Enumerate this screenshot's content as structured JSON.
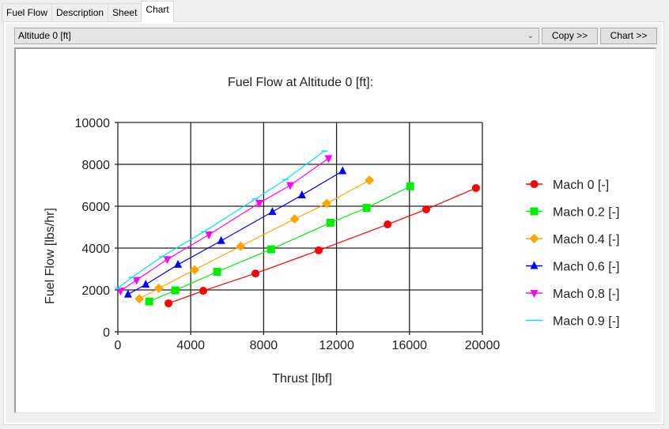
{
  "tabs": [
    {
      "label": "Fuel Flow",
      "active": false
    },
    {
      "label": "Description",
      "active": false
    },
    {
      "label": "Sheet",
      "active": false
    },
    {
      "label": "Chart",
      "active": true
    }
  ],
  "toolbar": {
    "selector_value": "Altitude 0 [ft]",
    "copy_label": "Copy >>",
    "chart_label": "Chart >>"
  },
  "chart_data": {
    "type": "line",
    "title": "Fuel Flow at Altitude 0 [ft]:",
    "xlabel": "Thrust [lbf]",
    "ylabel": "Fuel Flow [lbs/hr]",
    "xlim": [
      0,
      20000
    ],
    "ylim": [
      0,
      10000
    ],
    "xticks": [
      "0",
      "4000",
      "8000",
      "12000",
      "16000",
      "20000"
    ],
    "yticks": [
      "0",
      "2000",
      "4000",
      "6000",
      "8000",
      "10000"
    ],
    "grid": true,
    "legend_position": "right",
    "series": [
      {
        "name": "Mach 0 [-]",
        "color": "#ff0000",
        "marker": "circle",
        "x": [
          2780,
          4690,
          7550,
          11020,
          14800,
          16920,
          19650
        ],
        "y": [
          1360,
          1960,
          2790,
          3890,
          5130,
          5850,
          6870
        ]
      },
      {
        "name": "Mach 0.2 [-]",
        "color": "#00ee00",
        "marker": "square",
        "x": [
          1720,
          3150,
          5450,
          8410,
          11660,
          13650,
          16040
        ],
        "y": [
          1450,
          1980,
          2870,
          3940,
          5210,
          5920,
          6950
        ]
      },
      {
        "name": "Mach 0.4 [-]",
        "color": "#ffa500",
        "marker": "diamond",
        "x": [
          1180,
          2250,
          4210,
          6740,
          9700,
          11460,
          13800
        ],
        "y": [
          1580,
          2080,
          2960,
          4090,
          5390,
          6130,
          7240
        ]
      },
      {
        "name": "Mach 0.6 [-]",
        "color": "#0000ff",
        "marker": "triangle-up",
        "x": [
          560,
          1530,
          3300,
          5670,
          8480,
          10100,
          12330
        ],
        "y": [
          1790,
          2260,
          3210,
          4350,
          5730,
          6530,
          7680
        ]
      },
      {
        "name": "Mach 0.8 [-]",
        "color": "#ff00ff",
        "marker": "triangle-down",
        "x": [
          150,
          1030,
          2710,
          5000,
          7760,
          9460,
          11560
        ],
        "y": [
          1960,
          2470,
          3460,
          4640,
          6150,
          7000,
          8290
        ]
      },
      {
        "name": "Mach 0.9 [-]",
        "color": "#00e5ee",
        "marker": "dash",
        "x": [
          0,
          770,
          2440,
          4740,
          7530,
          9200,
          11340
        ],
        "y": [
          2080,
          2600,
          3600,
          4790,
          6340,
          7270,
          8640
        ]
      }
    ]
  }
}
